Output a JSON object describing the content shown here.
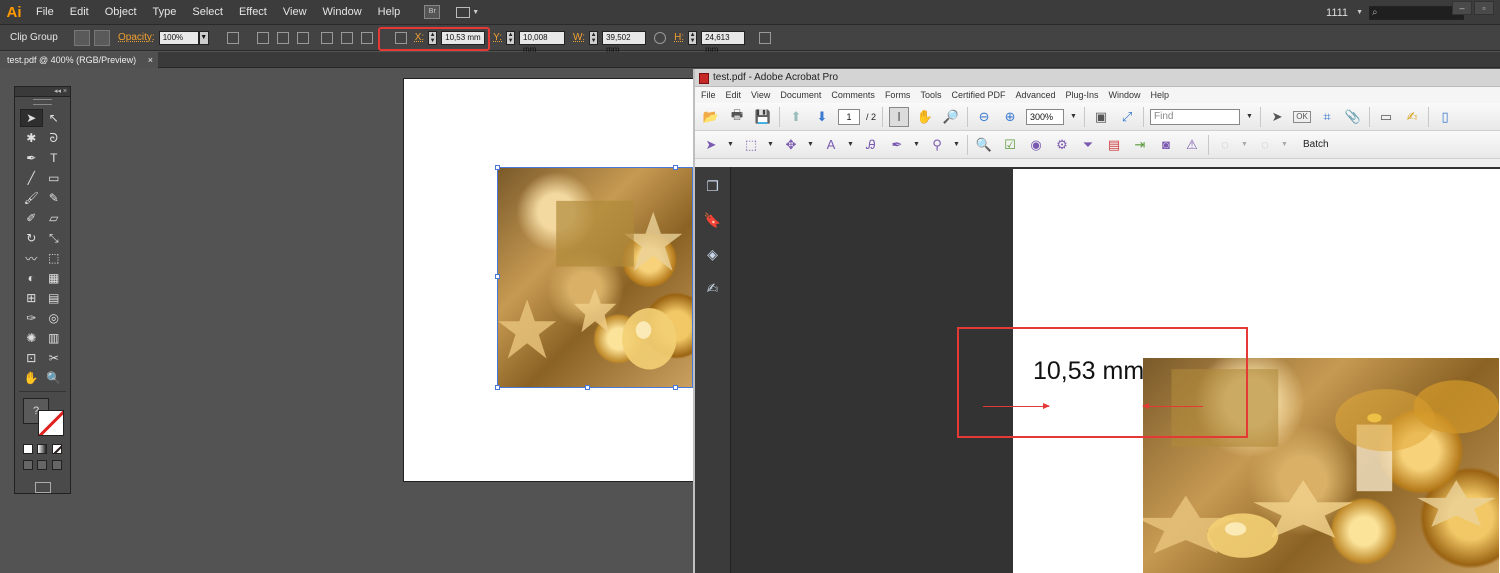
{
  "illustrator": {
    "logo": "Ai",
    "menu": [
      "File",
      "Edit",
      "Object",
      "Type",
      "Select",
      "Effect",
      "View",
      "Window",
      "Help"
    ],
    "bridge_label": "Br",
    "workspace": "1111",
    "window_buttons": [
      "–",
      "▫"
    ],
    "control_bar": {
      "selection": "Clip Group",
      "opacity_label": "Opacity:",
      "opacity_value": "100%",
      "x_label": "X:",
      "x_value": "10,53 mm",
      "y_label": "Y:",
      "y_value": "10,008 mm",
      "w_label": "W:",
      "w_value": "39,502 mm",
      "h_label": "H:",
      "h_value": "24,613 mm"
    },
    "doc_tab": {
      "title": "test.pdf @ 400% (RGB/Preview)",
      "close": "×"
    },
    "tools_panel": {
      "header": "◂◂ ×",
      "fill_glyph": "?"
    }
  },
  "acrobat": {
    "title": "test.pdf - Adobe Acrobat Pro",
    "menu": [
      "File",
      "Edit",
      "View",
      "Document",
      "Comments",
      "Forms",
      "Tools",
      "Certified PDF",
      "Advanced",
      "Plug-Ins",
      "Window",
      "Help"
    ],
    "page_current": "1",
    "page_total": "/ 2",
    "zoom": "300%",
    "find_placeholder": "Find",
    "batch_label": "Batch",
    "annotation_text": "10,53 mm"
  },
  "colors": {
    "highlight": "#e53935",
    "ai_orange": "#ff9a00"
  }
}
